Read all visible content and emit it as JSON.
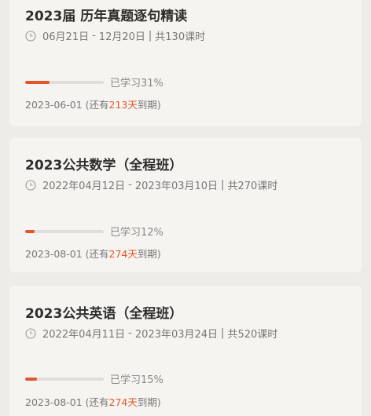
{
  "courses": [
    {
      "title": "2023届 历年真题逐句精读",
      "start": "06月21日",
      "end": "12月20日",
      "total": "共130课时",
      "progress_label": "已学习31%",
      "progress": 0.31,
      "expiry_date": "2023-06-01",
      "remain_prefix": "(还有",
      "remain_days": "213天",
      "remain_suffix": "到期)"
    },
    {
      "title": "2023公共数学（全程班）",
      "start": "2022年04月12日",
      "end": "2023年03月10日",
      "total": "共270课时",
      "progress_label": "已学习12%",
      "progress": 0.12,
      "expiry_date": "2023-08-01",
      "remain_prefix": "(还有",
      "remain_days": "274天",
      "remain_suffix": "到期)"
    },
    {
      "title": "2023公共英语（全程班）",
      "start": "2022年04月11日",
      "end": "2023年03月24日",
      "total": "共520课时",
      "progress_label": "已学习15%",
      "progress": 0.15,
      "expiry_date": "2023-08-01",
      "remain_prefix": "(还有",
      "remain_days": "274天",
      "remain_suffix": "到期)"
    }
  ],
  "separators": {
    "range": "-",
    "pipe": "|"
  },
  "icons": {
    "time": "clock-icon"
  },
  "colors": {
    "accent": "#e2562a",
    "track": "#e0ded8"
  }
}
